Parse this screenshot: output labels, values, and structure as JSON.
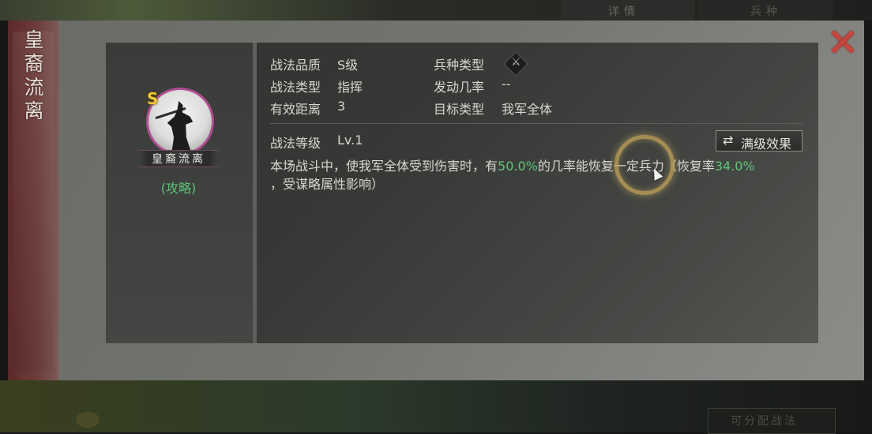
{
  "background": {
    "top_tabs": [
      "详情",
      "兵种"
    ],
    "bottom_button": "可分配战法"
  },
  "banner": {
    "title": "皇裔流离"
  },
  "skill_card": {
    "grade_badge": "S",
    "skill_name": "皇裔流离",
    "guide_link": "(攻略)",
    "attributes": {
      "quality_label": "战法品质",
      "quality_value": "S级",
      "troop_label": "兵种类型",
      "troop_icon": "troop-type-icon",
      "type_label": "战法类型",
      "type_value": "指挥",
      "rate_label": "发动几率",
      "rate_value": "--",
      "range_label": "有效距离",
      "range_value": "3",
      "target_label": "目标类型",
      "target_value": "我军全体"
    },
    "level_label": "战法等级",
    "level_value": "Lv.1",
    "full_level_button": "满级效果",
    "description": {
      "part1": "本场战斗中，使我军全体受到伤害时，有",
      "chance": "50.0%",
      "part2": "的几率能恢复一定兵力（恢复率",
      "recovery": "34.0%",
      "part3": "，受谋略属性影响）"
    }
  },
  "colors": {
    "highlight": "#5fc478",
    "close": "#c3473f",
    "portrait_border": "#b04e93",
    "grade": "#f1c933"
  }
}
